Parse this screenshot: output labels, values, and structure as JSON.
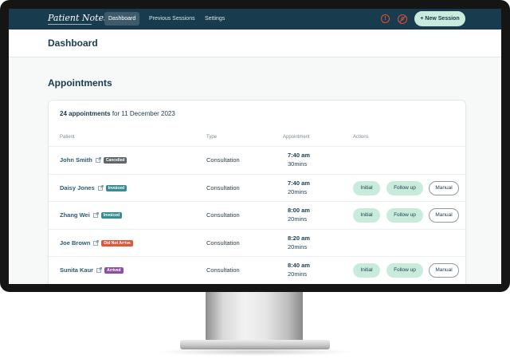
{
  "navbar": {
    "brand": "Patient Notes",
    "tabs": [
      {
        "label": "Dashboard",
        "active": true
      },
      {
        "label": "Previous Sessions",
        "active": false
      },
      {
        "label": "Settings",
        "active": false
      }
    ],
    "new_session_label": "+ New Session"
  },
  "page": {
    "title": "Dashboard",
    "section_title": "Appointments"
  },
  "appointments": {
    "count_label": "24 appointments",
    "date_label": "for 11 December 2023",
    "columns": [
      "Patient",
      "Type",
      "Appointment",
      "Actions"
    ],
    "rows": [
      {
        "name": "John Smith",
        "status": "Cancelled",
        "status_color": "#5f6569",
        "type": "Consultation",
        "time": "7:40 am",
        "duration": "30mins",
        "actions": []
      },
      {
        "name": "Daisy Jones",
        "status": "Invoiced",
        "status_color": "#3a8c93",
        "type": "Consultation",
        "time": "7:40 am",
        "duration": "20mins",
        "actions": [
          "Initial",
          "Follow up",
          "Manual"
        ]
      },
      {
        "name": "Zhang Wei",
        "status": "Invoiced",
        "status_color": "#3a8c93",
        "type": "Consultation",
        "time": "8:00 am",
        "duration": "20mins",
        "actions": [
          "Initial",
          "Follow up",
          "Manual"
        ]
      },
      {
        "name": "Joe Brown",
        "status": "Did Not Arrive",
        "status_color": "#e0563a",
        "type": "Consultation",
        "time": "8:20 am",
        "duration": "20mins",
        "actions": []
      },
      {
        "name": "Sunita Kaur",
        "status": "Arrived",
        "status_color": "#8a4fa5",
        "type": "Consultation",
        "time": "8:40 am",
        "duration": "20mins",
        "actions": [
          "Initial",
          "Follow up",
          "Manual"
        ]
      }
    ]
  },
  "colors": {
    "navbar": "#183b4d",
    "accent_mint": "#c8ebdc",
    "alert_red": "#e24d3b"
  },
  "icons": [
    "alert-circle-icon",
    "no-recording-icon",
    "external-link-icon",
    "plus-icon"
  ]
}
